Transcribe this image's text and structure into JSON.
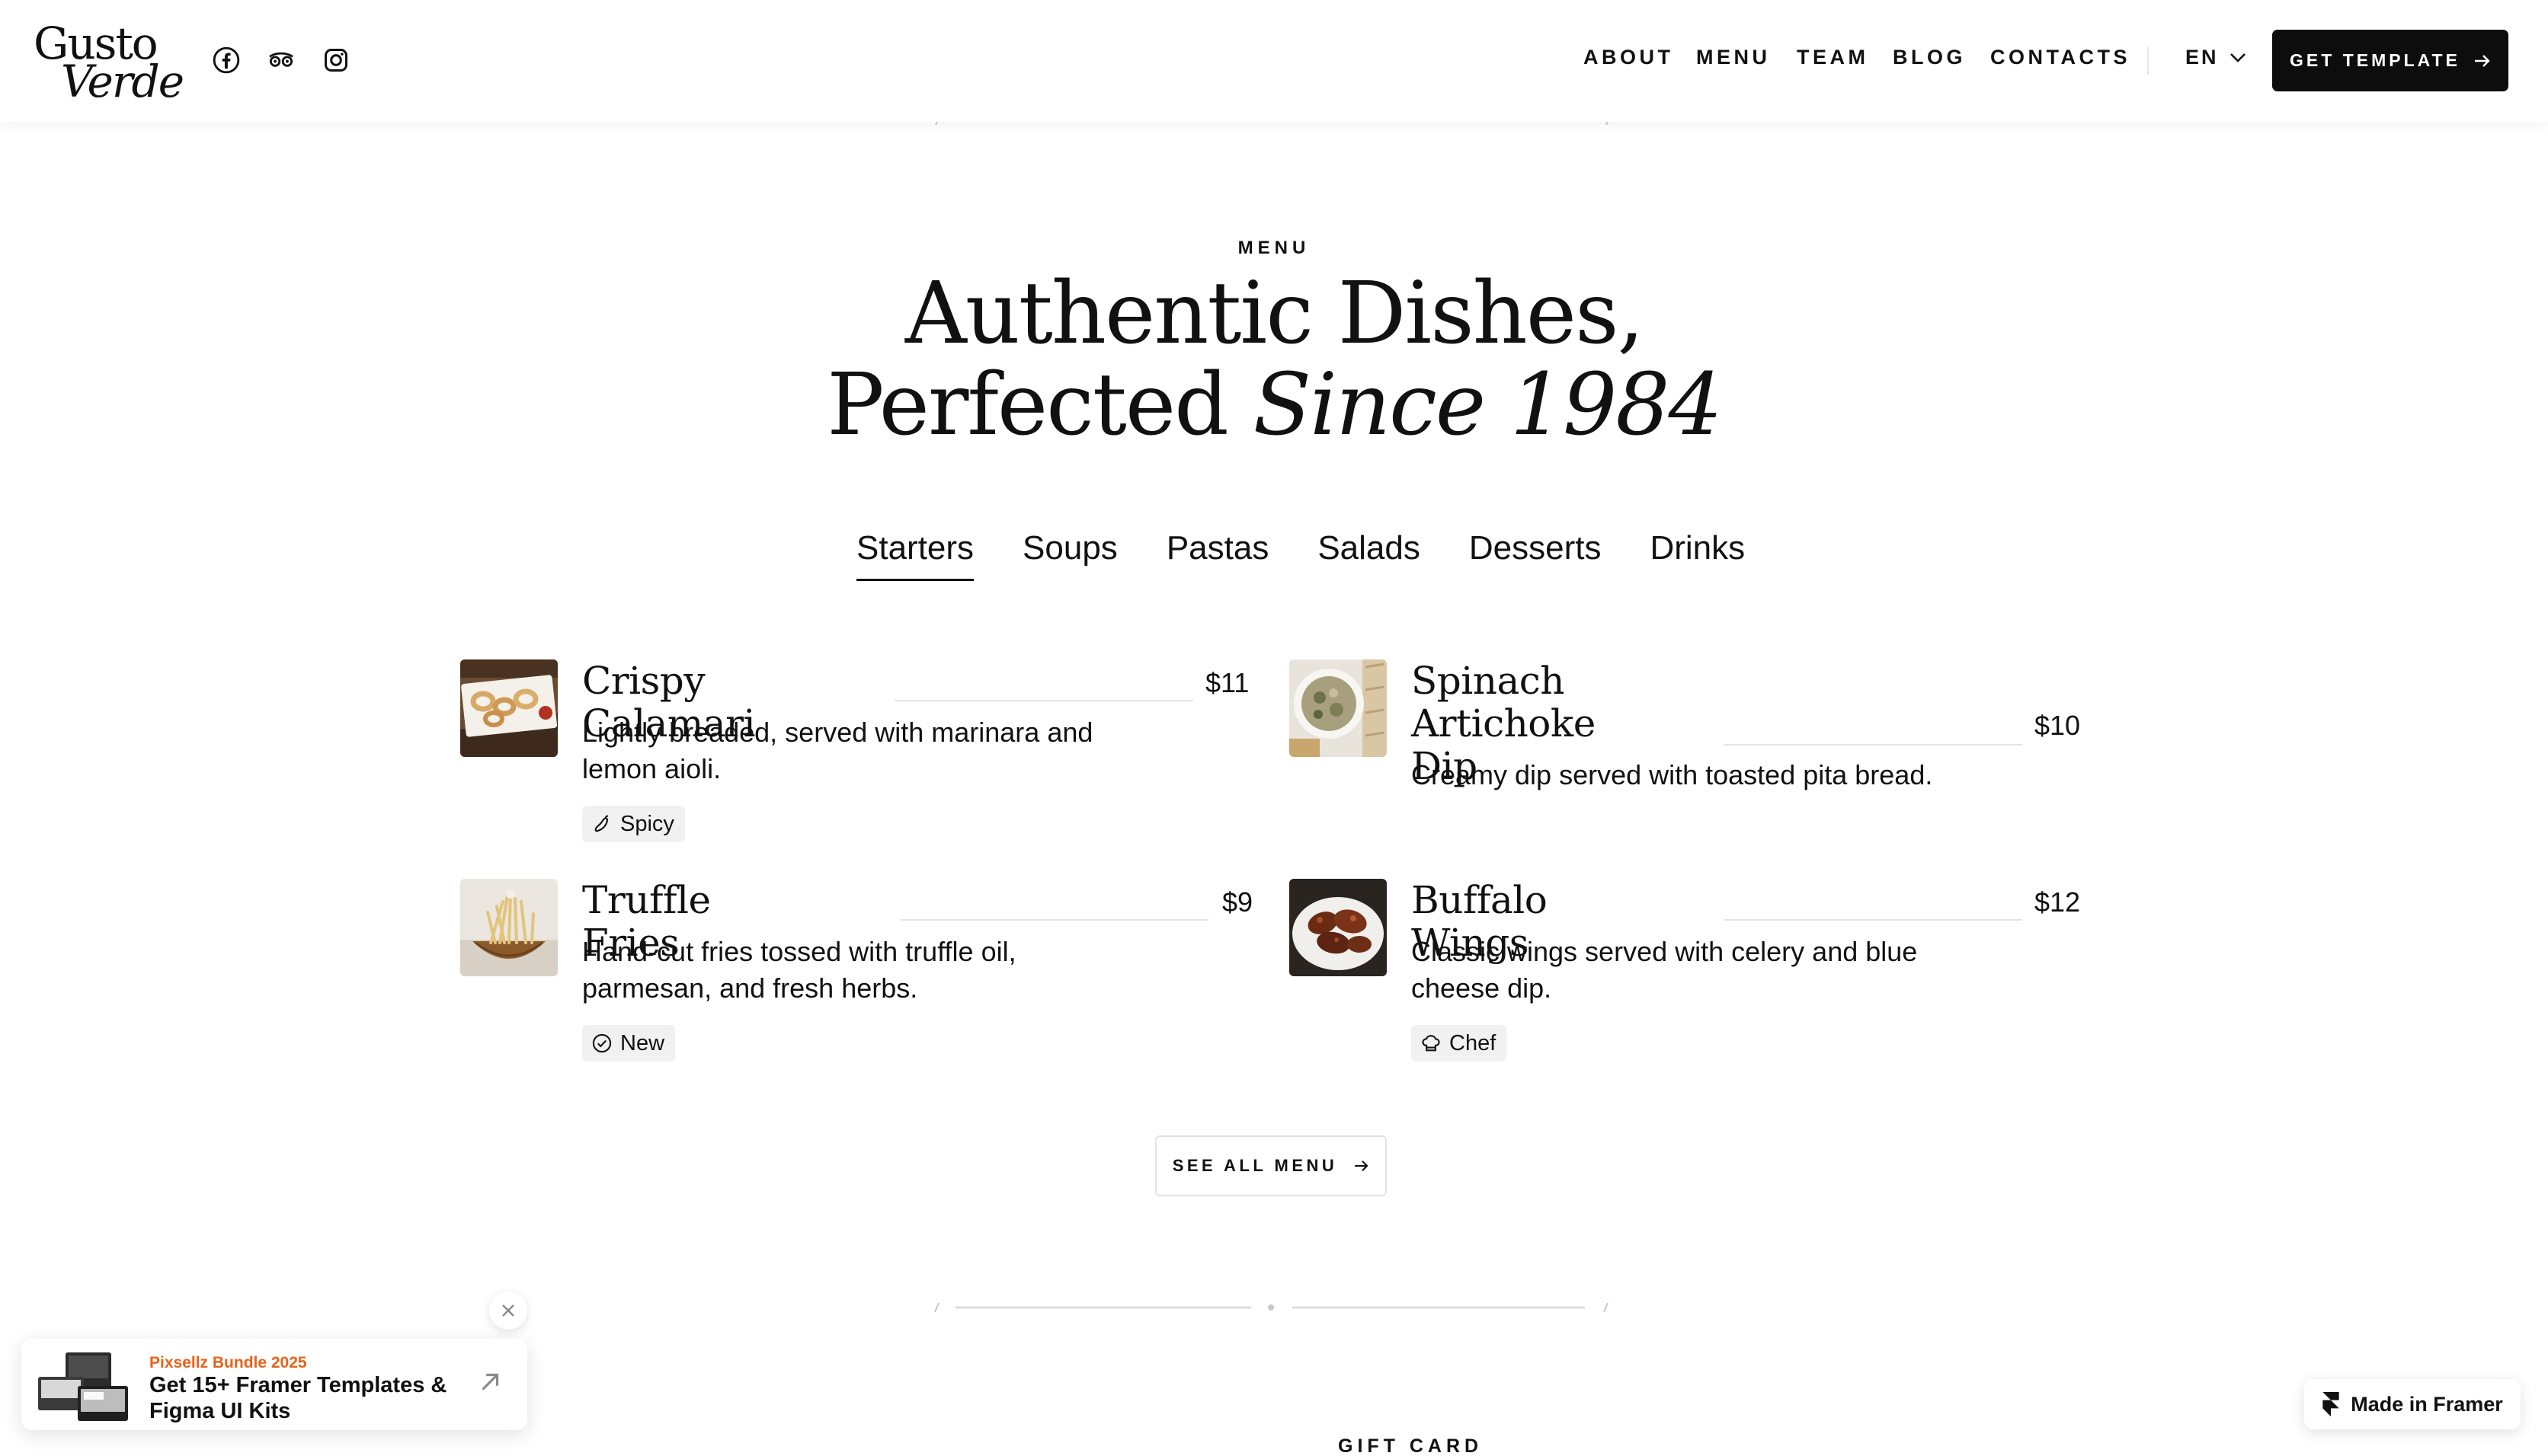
{
  "header": {
    "logo_line1": "Gusto",
    "logo_line2": "Verde",
    "social": [
      {
        "icon": "facebook-icon"
      },
      {
        "icon": "tripadvisor-icon"
      },
      {
        "icon": "instagram-icon"
      }
    ],
    "nav": [
      "ABOUT",
      "MENU",
      "TEAM",
      "BLOG",
      "CONTACTS"
    ],
    "language": "EN",
    "cta_label": "GET TEMPLATE"
  },
  "hero": {
    "eyebrow": "MENU",
    "title_line1": "Authentic Dishes,",
    "title_line2_plain": "Perfected ",
    "title_line2_italic": "Since 1984"
  },
  "tabs": [
    {
      "label": "Starters",
      "active": true
    },
    {
      "label": "Soups",
      "active": false
    },
    {
      "label": "Pastas",
      "active": false
    },
    {
      "label": "Salads",
      "active": false
    },
    {
      "label": "Desserts",
      "active": false
    },
    {
      "label": "Drinks",
      "active": false
    }
  ],
  "menu_items": [
    {
      "name": "Crispy Calamari",
      "price": "$11",
      "description": "Lightly breaded, served with marinara and lemon aioli.",
      "badge": "Spicy",
      "badge_icon": "chili-icon"
    },
    {
      "name": "Spinach Artichoke Dip",
      "price": "$10",
      "description": "Creamy dip served with toasted pita bread.",
      "badge": "",
      "badge_icon": ""
    },
    {
      "name": "Truffle Fries",
      "price": "$9",
      "description": "Hand-cut fries tossed with truffle oil, parmesan, and fresh herbs.",
      "badge": "New",
      "badge_icon": "check-circle-icon"
    },
    {
      "name": "Buffalo Wings",
      "price": "$12",
      "description": "Classic wings served with celery and blue cheese dip.",
      "badge": "Chef",
      "badge_icon": "chef-hat-icon"
    }
  ],
  "see_all_label": "SEE ALL MENU",
  "next_section_eyebrow": "GIFT CARD",
  "promo": {
    "eyebrow": "Pixsellz Bundle 2025",
    "title": "Get 15+ Framer Templates & Figma UI Kits"
  },
  "framer_badge": "Made in Framer",
  "colors": {
    "accent_dark": "#0d0d0d",
    "promo_orange": "#e8621a",
    "badge_bg": "#f1f1f1",
    "divider": "#e4e4e4"
  }
}
